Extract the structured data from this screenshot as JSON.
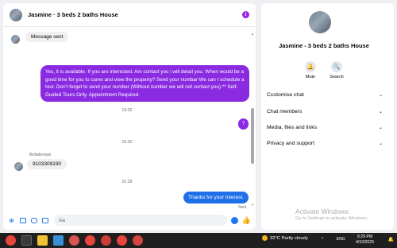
{
  "header": {
    "title": "Jasmine · 3 beds 2 baths House"
  },
  "messages": {
    "m1": "Message sent",
    "m2": "Yes, it is available. If you are interested.  Am contact you i will detail you.  When would be a good time for you to come and view the property? Send your numbar We can I schedule a tour.  Don't forget to send your number (Without number we will not contact you).** Self-Guided Tours Only. Appointment Required.",
    "t1": "13:32",
    "m3": "?",
    "t2": "15:20",
    "sender": "Befadomyie",
    "m4": "9103309190",
    "t3": "21:29",
    "m5": "Thanks for your interest.",
    "status": "Sent"
  },
  "composer": {
    "placeholder": "Aa"
  },
  "side": {
    "title": "Jasmine - 3 beds 2 baths House",
    "mute": "Mute",
    "search": "Search",
    "sections": [
      "Customise chat",
      "Chat members",
      "Media, files and links",
      "Privacy and support"
    ]
  },
  "watermark": {
    "line1": "Activate Windows",
    "line2": "Go to Settings to activate Windows."
  },
  "taskbar": {
    "weather": "32°C  Partly cloudy",
    "lang": "ENG",
    "time": "9:29 PM",
    "date": "4/10/2025"
  }
}
